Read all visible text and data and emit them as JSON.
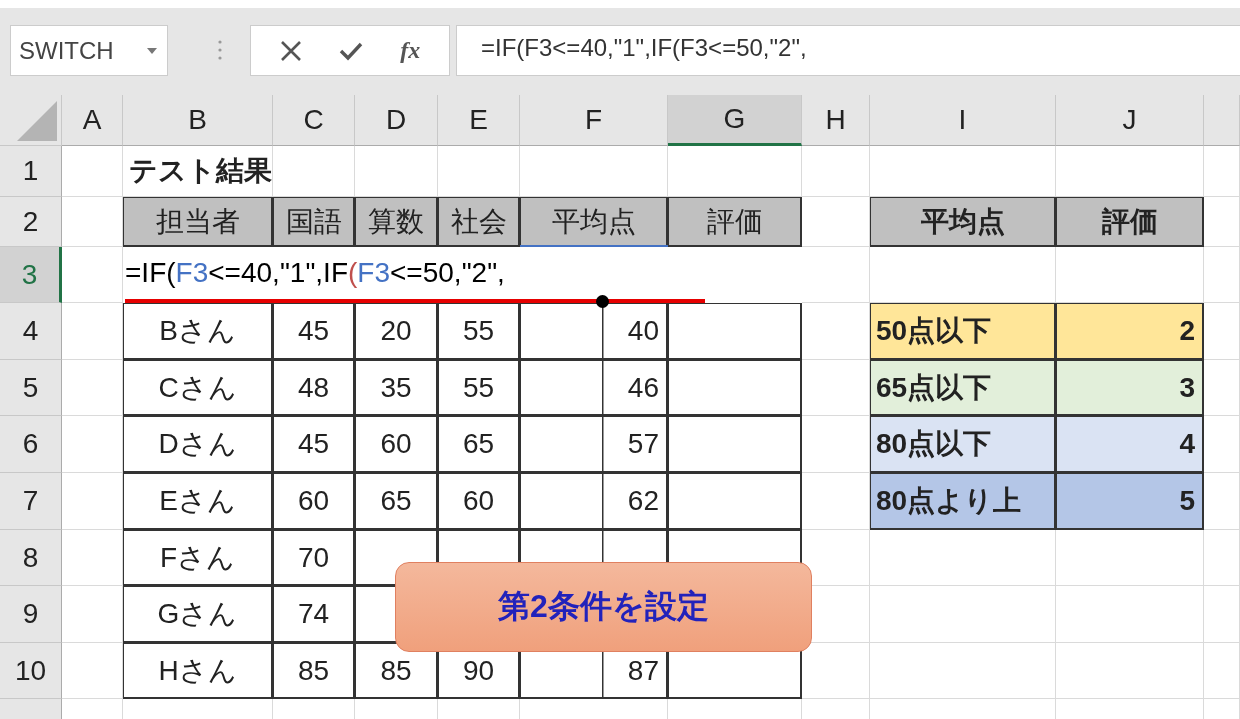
{
  "formula_bar": {
    "name_box": "SWITCH",
    "fx_label": "fx",
    "formula": "=IF(F3<=40,\"1\",IF(F3<=50,\"2\","
  },
  "columns": [
    {
      "label": "A",
      "selected": false
    },
    {
      "label": "B",
      "selected": false
    },
    {
      "label": "C",
      "selected": false
    },
    {
      "label": "D",
      "selected": false
    },
    {
      "label": "E",
      "selected": false
    },
    {
      "label": "F",
      "selected": false
    },
    {
      "label": "G",
      "selected": true
    },
    {
      "label": "H",
      "selected": false
    },
    {
      "label": "I",
      "selected": false
    },
    {
      "label": "J",
      "selected": false
    }
  ],
  "rows": [
    {
      "label": "1",
      "selected": false
    },
    {
      "label": "2",
      "selected": false
    },
    {
      "label": "3",
      "selected": true
    },
    {
      "label": "4",
      "selected": false
    },
    {
      "label": "5",
      "selected": false
    },
    {
      "label": "6",
      "selected": false
    },
    {
      "label": "7",
      "selected": false
    },
    {
      "label": "8",
      "selected": false
    },
    {
      "label": "9",
      "selected": false
    },
    {
      "label": "10",
      "selected": false
    }
  ],
  "title": "テスト結果",
  "table": {
    "columns": [
      "担当者",
      "国語",
      "算数",
      "社会",
      "平均点",
      "評価"
    ],
    "editing_formula": [
      {
        "text": "=IF(",
        "color": "#000000"
      },
      {
        "text": "F3",
        "color": "#4472c4"
      },
      {
        "text": "<=40,\"1\",IF",
        "color": "#000000"
      },
      {
        "text": "(",
        "color": "#c0504d"
      },
      {
        "text": "F3",
        "color": "#4472c4"
      },
      {
        "text": "<=50,\"2\",",
        "color": "#000000"
      }
    ],
    "rows": [
      {
        "name": "Bさん",
        "japanese": "45",
        "math": "20",
        "social": "55",
        "average": "40"
      },
      {
        "name": "Cさん",
        "japanese": "48",
        "math": "35",
        "social": "55",
        "average": "46"
      },
      {
        "name": "Dさん",
        "japanese": "45",
        "math": "60",
        "social": "65",
        "average": "57"
      },
      {
        "name": "Eさん",
        "japanese": "60",
        "math": "65",
        "social": "60",
        "average": "62"
      },
      {
        "name": "Fさん",
        "japanese": "70"
      },
      {
        "name": "Gさん",
        "japanese": "74"
      },
      {
        "name": "Hさん",
        "japanese": "85",
        "math": "85",
        "social": "90",
        "average": "87"
      }
    ]
  },
  "lookup": {
    "columns": [
      "平均点",
      "評価"
    ],
    "rows": [
      {
        "label": "50点以下",
        "grade": "2",
        "color": "#ffe699"
      },
      {
        "label": "65点以下",
        "grade": "3",
        "color": "#e2efda"
      },
      {
        "label": "80点以下",
        "grade": "4",
        "color": "#dae3f3"
      },
      {
        "label": "80点より上",
        "grade": "5",
        "color": "#b4c6e7"
      }
    ]
  },
  "callout": "第2条件を設定"
}
